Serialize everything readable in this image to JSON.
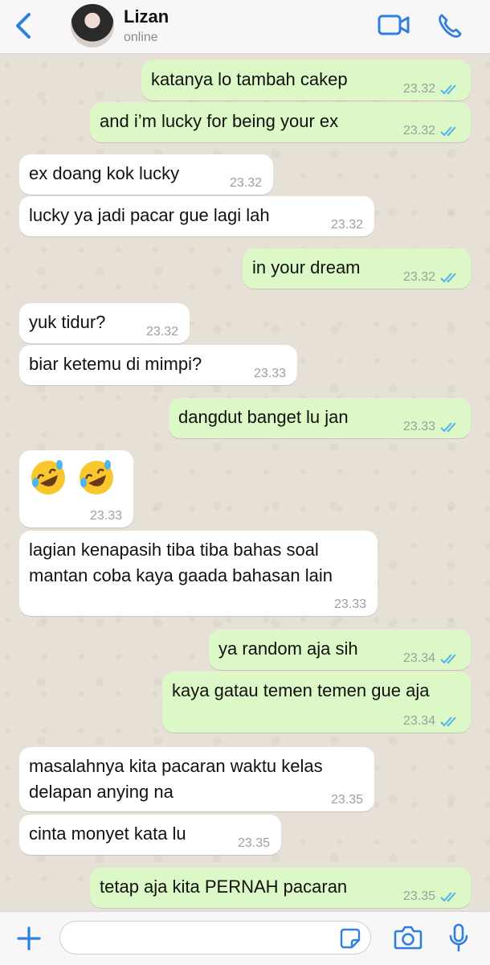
{
  "header": {
    "contact_name": "Lizan",
    "contact_status": "online"
  },
  "messages": [
    {
      "side": "out",
      "text": "katanya lo tambah cakep",
      "time": "23.32",
      "read": true
    },
    {
      "side": "out",
      "text": "and i’m lucky for being your ex",
      "time": "23.32",
      "read": true
    },
    {
      "side": "in",
      "text": "ex doang kok lucky",
      "time": "23.32"
    },
    {
      "side": "in",
      "text": "lucky ya jadi pacar gue lagi lah",
      "time": "23.32"
    },
    {
      "side": "out",
      "text": "in your dream",
      "time": "23.32",
      "read": true
    },
    {
      "side": "in",
      "text": "yuk tidur?",
      "time": "23.32"
    },
    {
      "side": "in",
      "text": "biar ketemu di mimpi?",
      "time": "23.33"
    },
    {
      "side": "out",
      "text": "dangdut banget lu jan",
      "time": "23.33",
      "read": true
    },
    {
      "side": "in",
      "emoji": [
        "rolling-on-floor-laughing",
        "rolling-on-floor-laughing"
      ],
      "time": "23.33"
    },
    {
      "side": "in",
      "line1": "lagian kenapasih tiba tiba bahas soal",
      "line2": "mantan coba kaya gaada bahasan lain",
      "time": "23.33"
    },
    {
      "side": "out",
      "text": "ya random aja sih",
      "time": "23.34",
      "read": true
    },
    {
      "side": "out",
      "text": "kaya gatau temen temen gue aja",
      "time": "23.34",
      "read": true
    },
    {
      "side": "in",
      "line1": "masalahnya kita pacaran waktu kelas",
      "line2": "delapan anying na",
      "time": "23.35"
    },
    {
      "side": "in",
      "text": "cinta monyet kata lu",
      "time": "23.35"
    },
    {
      "side": "out",
      "text": "tetap aja kita PERNAH pacaran",
      "time": "23.35",
      "read": true
    }
  ],
  "composer": {
    "placeholder": ""
  },
  "colors": {
    "accent": "#2f7fe0",
    "outgoing_bubble": "#dcf8c6",
    "incoming_bubble": "#ffffff",
    "read_ticks": "#4fb6ec"
  },
  "icons": [
    "back-chevron-icon",
    "video-call-icon",
    "phone-icon",
    "plus-icon",
    "sticker-icon",
    "camera-icon",
    "microphone-icon",
    "double-check-icon"
  ]
}
